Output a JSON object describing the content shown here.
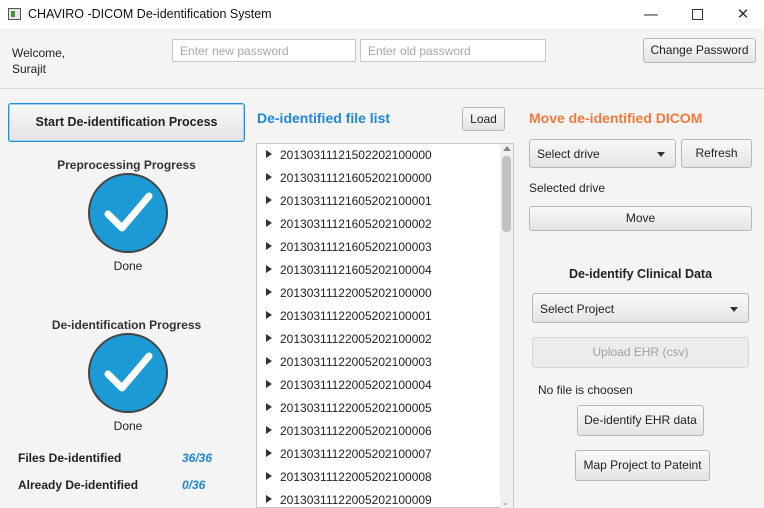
{
  "window": {
    "title": "CHAVIRO -DICOM De-identification System",
    "app_icon": "window-app-icon",
    "controls": {
      "minimize": "—",
      "maximize": "",
      "close": "✕"
    }
  },
  "header": {
    "welcome_line1": "Welcome,",
    "welcome_line2": "Surajit",
    "new_password_placeholder": "Enter new password",
    "old_password_placeholder": "Enter old password",
    "change_password_label": "Change Password"
  },
  "left_panel": {
    "start_button_label": "Start De-identification Process",
    "preprocessing": {
      "title": "Preprocessing Progress",
      "status": "Done",
      "icon": "check-circle-icon"
    },
    "deidentification": {
      "title": "De-identification Progress",
      "status": "Done",
      "icon": "check-circle-icon"
    },
    "stats": [
      {
        "label": "Files De-identified",
        "value": "36/36"
      },
      {
        "label": "Already De-identified",
        "value": "0/36"
      }
    ]
  },
  "middle_panel": {
    "title": "De-identified file list",
    "load_label": "Load",
    "files": [
      "20130311121502202100000",
      "20130311121605202100000",
      "20130311121605202100001",
      "20130311121605202100002",
      "20130311121605202100003",
      "20130311121605202100004",
      "20130311122005202100000",
      "20130311122005202100001",
      "20130311122005202100002",
      "20130311122005202100003",
      "20130311122005202100004",
      "20130311122005202100005",
      "20130311122005202100006",
      "20130311122005202100007",
      "20130311122005202100008",
      "20130311122005202100009"
    ]
  },
  "right_panel": {
    "move_title": "Move de-identified DICOM",
    "select_drive_label": "Select drive",
    "refresh_label": "Refresh",
    "selected_drive_text": "Selected drive",
    "move_label": "Move",
    "clinical_title": "De-identify Clinical Data",
    "select_project_label": "Select Project",
    "upload_label": "Upload EHR (csv)",
    "no_file_text": "No file is choosen",
    "deidentify_ehr_label": "De-identify EHR data",
    "map_project_label": "Map Project to Pateint"
  },
  "colors": {
    "accent_blue": "#2186d8",
    "accent_orange": "#ef7a3c",
    "check_blue": "#1c9ad6"
  }
}
